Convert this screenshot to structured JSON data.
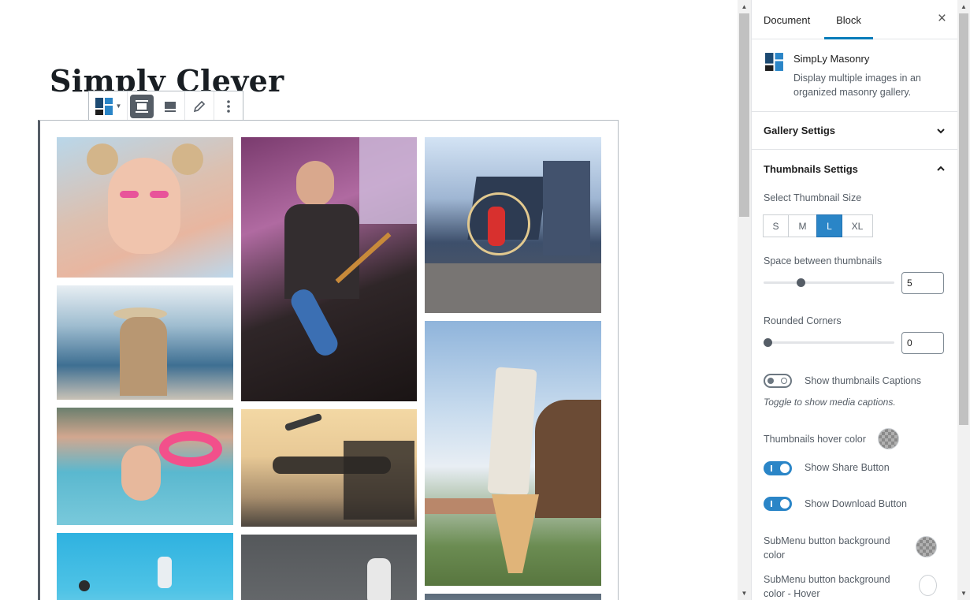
{
  "editor": {
    "post_title": "Simply Clever",
    "toolbar": {
      "buttons": [
        "block-type-switcher",
        "align-wide",
        "align-full",
        "edit",
        "more-options"
      ]
    },
    "gallery": {
      "images": [
        "portrait-pink-eyeshadow",
        "guitarist-concert",
        "hula-hoop-dancer",
        "woman-on-boat",
        "leaning-tower-ice-cream",
        "pool-party-flamingo",
        "airport-lounge-plane",
        "swimmer-pool",
        "street-footballer"
      ]
    }
  },
  "sidebar": {
    "tabs": [
      "Document",
      "Block"
    ],
    "active_tab": "Block",
    "close_label": "×",
    "block": {
      "title": "SimpLy Masonry",
      "description": "Display multiple images in an organized masonry gallery."
    },
    "panels": {
      "gallery_settings": "Gallery Settigs",
      "thumbnails_settings": "Thumbnails Settigs"
    },
    "thumbnail_size": {
      "label": "Select Thumbnail Size",
      "options": [
        "S",
        "M",
        "L",
        "XL"
      ],
      "selected": "L"
    },
    "space": {
      "label": "Space between thumbnails",
      "value": "5",
      "slider_fraction": 0.27
    },
    "corners": {
      "label": "Rounded Corners",
      "value": "0",
      "slider_fraction": 0.0
    },
    "captions": {
      "label": "Show thumbnails Captions",
      "help": "Toggle to show media captions.",
      "on": false
    },
    "hover_color": {
      "label": "Thumbnails hover color"
    },
    "share": {
      "label": "Show Share Button",
      "on": true
    },
    "download": {
      "label": "Show Download Button",
      "on": true
    },
    "submenu_bg": {
      "label": "SubMenu button background color"
    },
    "submenu_bg_hover": {
      "label": "SubMenu button background color - Hover"
    }
  },
  "colors": {
    "accent": "#2a85c7",
    "border": "#e2e4e7",
    "text_muted": "#555d66"
  }
}
